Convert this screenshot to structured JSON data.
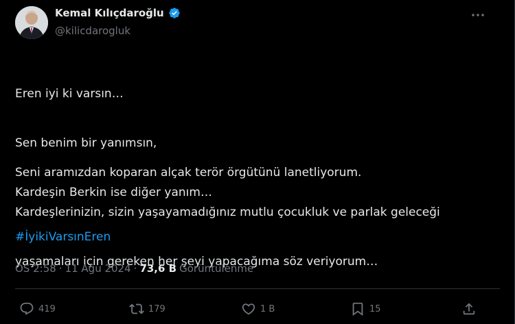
{
  "author": {
    "name": "Kemal Kılıçdaroğlu",
    "handle": "@kilicdarogluk",
    "verified_color": "#1d9bf0"
  },
  "tweet": {
    "stanza1": [
      "Eren iyi ki varsın…",
      "Sen benim bir yanımsın,",
      "Kardeşin Berkin ise diğer yanım…"
    ],
    "stanza2": [
      "Seni aramızdan koparan alçak terör örgütünü lanetliyorum."
    ],
    "stanza3": [
      "Kardeşlerinizin, sizin yaşayamadığınız mutlu çocukluk ve parlak geleceği",
      "yaşamaları için gereken her şeyi yapacağıma söz veriyorum…"
    ],
    "hashtag": "#İyikiVarsınEren"
  },
  "meta": {
    "time": "ÖS 2:58",
    "separator": "·",
    "date": "11 Ağu 2024",
    "views_count": "73,6 B",
    "views_label": "Görüntülenme"
  },
  "actions": {
    "replies": "419",
    "reposts": "179",
    "likes": "1 B",
    "bookmarks": "15"
  },
  "icons": {
    "more": "more-horizontal-icon",
    "reply": "reply-icon",
    "repost": "repost-icon",
    "like": "heart-icon",
    "bookmark": "bookmark-icon",
    "share": "share-icon"
  }
}
